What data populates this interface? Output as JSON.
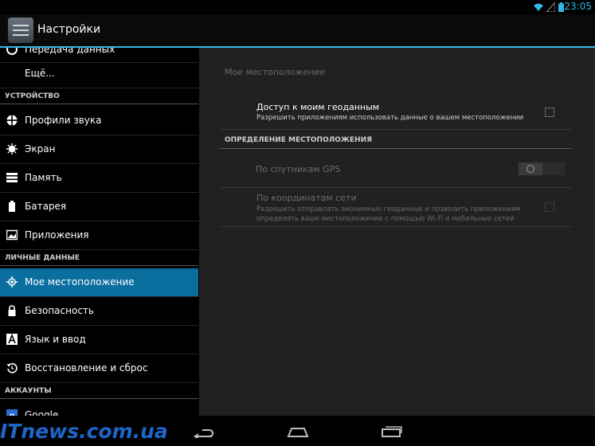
{
  "status_bar": {
    "time": "23:05",
    "accent": "#33b5e5"
  },
  "action_bar": {
    "title": "Настройки"
  },
  "sidebar": {
    "partial_item": "Передача данных",
    "more_item": "Ещё...",
    "sections": [
      {
        "header": "УСТРОЙСТВО",
        "items": [
          {
            "label": "Профили звука",
            "icon": "sound-profile-icon"
          },
          {
            "label": "Экран",
            "icon": "display-icon"
          },
          {
            "label": "Память",
            "icon": "storage-icon"
          },
          {
            "label": "Батарея",
            "icon": "battery-icon"
          },
          {
            "label": "Приложения",
            "icon": "apps-icon"
          }
        ]
      },
      {
        "header": "ЛИЧНЫЕ ДАННЫЕ",
        "items": [
          {
            "label": "Мое местоположение",
            "icon": "location-icon",
            "selected": true
          },
          {
            "label": "Безопасность",
            "icon": "lock-icon"
          },
          {
            "label": "Язык и ввод",
            "icon": "keyboard-icon"
          },
          {
            "label": "Восстановление и сброс",
            "icon": "restore-icon"
          }
        ]
      },
      {
        "header": "АККАУНТЫ",
        "items": [
          {
            "label": "Google",
            "icon": "google-icon"
          }
        ]
      }
    ],
    "selected_color": "#0a6e9e"
  },
  "detail": {
    "title": "Мое местоположение",
    "access": {
      "title": "Доступ к моим геоданным",
      "summary": "Разрешить приложениям использовать данные о вашем местоположении",
      "checked": false
    },
    "category": "ОПРЕДЕЛЕНИЕ МЕСТОПОЛОЖЕНИЯ",
    "gps": {
      "title": "По спутникам GPS",
      "enabled": false,
      "state": "off"
    },
    "network": {
      "title": "По координатам сети",
      "summary_line1": "Разрешить отправлять анонимные геоданные и позволить приложениям",
      "summary_line2": "определять ваше местоположение с помощью Wi-Fi и мобильных сетей",
      "enabled": false,
      "checked": false
    }
  },
  "nav_bar": {
    "back": "back-icon",
    "home": "home-icon",
    "recents": "recents-icon"
  },
  "watermark": "ITnews.com.ua"
}
